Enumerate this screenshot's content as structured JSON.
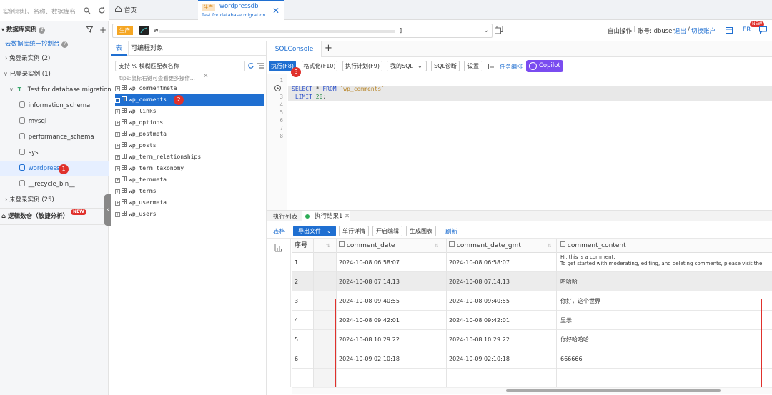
{
  "left": {
    "search_placeholder": "实例地址、名称、数据库名",
    "section_title": "数据库实例",
    "console_link": "云数据库统一控制台",
    "groups": {
      "free_login": "免登录实例",
      "free_login_count": "(2)",
      "logged_in": "已登录实例",
      "logged_in_count": "(1)",
      "instance_env": "T",
      "instance_name": "Test for database migration",
      "databases": [
        "information_schema",
        "mysql",
        "performance_schema",
        "sys",
        "wordpressdb",
        "__recycle_bin__"
      ],
      "not_logged": "未登录实例",
      "not_logged_count": "(25)"
    },
    "logic_db": "逻辑数仓（敏捷分析）",
    "new_badge": "NEW",
    "step1": "1"
  },
  "topbar": {
    "home_tab": "首页",
    "active_tab_env": "生产",
    "active_tab_title": "wordpressdb",
    "active_tab_subtitle": "Test for database migration"
  },
  "addr": {
    "env": "生产",
    "instance_prefix": "w",
    "instance_suffix": "]",
    "mode_label": "自由操作",
    "account_label": "账号: dbuser",
    "logout": "退出",
    "switch_account": "切换账户",
    "er_label": "ER",
    "er_badge": "NEW"
  },
  "mid": {
    "tabs": [
      "表",
      "可编程对象"
    ],
    "search_placeholder": "支持 % 模糊匹配表名称",
    "tip": "tips:鼠标右键可查看更多操作...",
    "tables": [
      "wp_commentmeta",
      "wp_comments",
      "wp_links",
      "wp_options",
      "wp_postmeta",
      "wp_posts",
      "wp_term_relationships",
      "wp_term_taxonomy",
      "wp_termmeta",
      "wp_terms",
      "wp_usermeta",
      "wp_users"
    ],
    "step2": "2"
  },
  "console": {
    "tab": "SQLConsole",
    "add_tab": "+",
    "toolbar": {
      "execute": "执行(F8)",
      "format": "格式化(F10)",
      "plan": "执行计划(F9)",
      "my_sql": "我的SQL",
      "diagnose": "SQL诊断",
      "settings": "设置",
      "task": "任务编排",
      "copilot": "Copilot"
    },
    "step3": "3",
    "line_numbers": [
      "1",
      "2",
      "3",
      "4",
      "5",
      "6",
      "7",
      "8"
    ],
    "code": {
      "kw_select": "SELECT",
      "star": " * ",
      "kw_from": "FROM",
      "table": "`wp_comments`",
      "kw_limit": "LIMIT",
      "limit_val": "20",
      "semi": ";"
    }
  },
  "results": {
    "tabs": [
      "执行列表",
      "执行结果1"
    ],
    "toolbar": {
      "table_view": "表格",
      "export": "导出文件",
      "single_detail": "单行详情",
      "edit": "开启编辑",
      "chart": "生成图表",
      "refresh": "刷新"
    },
    "columns": [
      "序号",
      "comment_date",
      "comment_date_gmt",
      "comment_content"
    ],
    "rows": [
      {
        "n": "1",
        "date": "2024-10-08 06:58:07",
        "gmt": "2024-10-08 06:58:07",
        "content_1": "Hi, this is a comment.",
        "content_2": "To get started with moderating, editing, and deleting comments, please visit the"
      },
      {
        "n": "2",
        "date": "2024-10-08 07:14:13",
        "gmt": "2024-10-08 07:14:13",
        "content_1": "哈哈哈"
      },
      {
        "n": "3",
        "date": "2024-10-08 09:40:55",
        "gmt": "2024-10-08 09:40:55",
        "content_1": "你好，这个世界"
      },
      {
        "n": "4",
        "date": "2024-10-08 09:42:01",
        "gmt": "2024-10-08 09:42:01",
        "content_1": "显示"
      },
      {
        "n": "5",
        "date": "2024-10-08 10:29:22",
        "gmt": "2024-10-08 10:29:22",
        "content_1": "你好哈哈哈"
      },
      {
        "n": "6",
        "date": "2024-10-09 02:10:18",
        "gmt": "2024-10-09 02:10:18",
        "content_1": "666666"
      }
    ]
  },
  "colors": {
    "accent": "#1f6fd1",
    "badge_red": "#e0312c",
    "env_orange": "#f5a623",
    "copilot": "#7a4cf0"
  }
}
